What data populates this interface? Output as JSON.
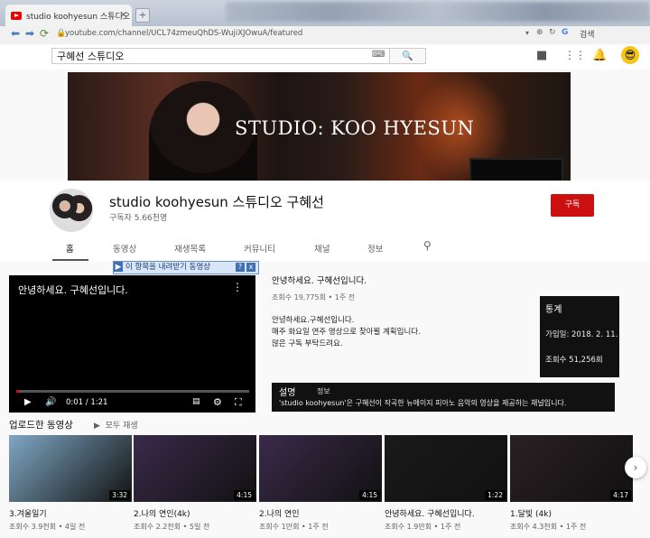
{
  "browser": {
    "tab_title": "studio koohyesun 스튜디오 구혜",
    "tab_close": "×",
    "new_tab": "+",
    "url": "youtube.com/channel/UCL74zmeuQhDS-WujiXJOwuA/featured",
    "search_engine_label": "검색"
  },
  "yt_header": {
    "search_value": "구혜선 스튜디오"
  },
  "banner": {
    "text": "STUDIO: KOO HYESUN"
  },
  "channel": {
    "name": "studio koohyesun 스튜디오 구혜선",
    "subscribers": "구독자 5.66천명",
    "subscribe_label": "구독"
  },
  "tabs": [
    "홈",
    "동영상",
    "재생목록",
    "커뮤니티",
    "채널",
    "정보"
  ],
  "popup": {
    "text": "이 항목을 내려받기 동영상",
    "help": "?",
    "close": "x"
  },
  "featured": {
    "player_title": "안녕하세요. 구혜선입니다.",
    "time": "0:01 / 1:21",
    "progress": 0.013,
    "title": "안녕하세요. 구혜선입니다.",
    "meta": "조회수 19,775회 • 1주 전",
    "desc_lines": [
      "안녕하세요.구혜선입니다.",
      "매주 화요일 연주 영상으로 찾아뵐 계획입니다.",
      "많은 구독 부탁드려요."
    ]
  },
  "stats": {
    "title": "통계",
    "joined": "가입일: 2018. 2. 11.",
    "views": "조회수 51,256회"
  },
  "about": {
    "heading": "설명",
    "subheading": "정보",
    "body": "'studio koohyesun'은 구혜선이 작곡한 뉴에이지 피아노 음악의 영상을 제공하는 채널입니다."
  },
  "uploads": {
    "title": "업로드한 동영상",
    "play_all": "모두 재생",
    "videos": [
      {
        "title": "3.겨울일기",
        "meta": "조회수 3.9천회 • 4일 전",
        "duration": "3:32",
        "bg": "#7fa7c4"
      },
      {
        "title": "2.나의 연인(4k)",
        "meta": "조회수 2.2천회 • 5일 전",
        "duration": "4:15",
        "bg": "#3a2a4a"
      },
      {
        "title": "2.나의 연인",
        "meta": "조회수 1만회 • 1주 전",
        "duration": "4:15",
        "bg": "#3a2a4a"
      },
      {
        "title": "안녕하세요. 구혜선입니다.",
        "meta": "조회수 1.9만회 • 1주 전",
        "duration": "1:22",
        "bg": "#1a1a1a"
      },
      {
        "title": "1.달빛 (4k)",
        "meta": "조회수 4.3천회 • 1주 전",
        "duration": "4:17",
        "bg": "#2a2024"
      }
    ]
  }
}
